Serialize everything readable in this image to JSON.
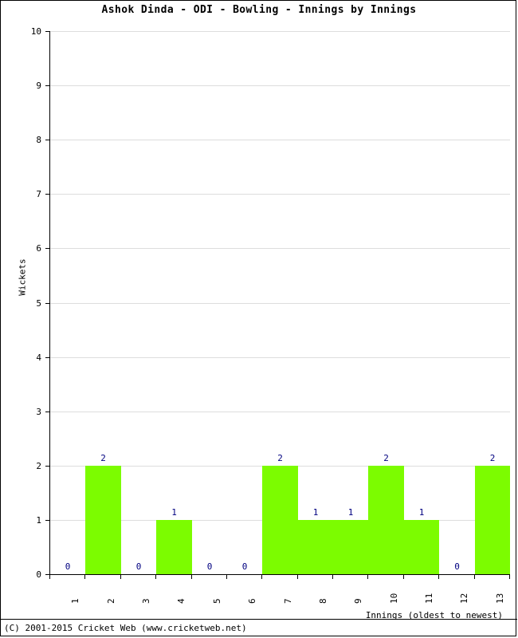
{
  "chart_data": {
    "type": "bar",
    "title": "Ashok Dinda - ODI - Bowling - Innings by Innings",
    "xlabel": "Innings (oldest to newest)",
    "ylabel": "Wickets",
    "categories": [
      "1",
      "2",
      "3",
      "4",
      "5",
      "6",
      "7",
      "8",
      "9",
      "10",
      "11",
      "12",
      "13"
    ],
    "values": [
      0,
      2,
      0,
      1,
      0,
      0,
      2,
      1,
      1,
      2,
      1,
      0,
      2
    ],
    "data_labels": [
      "0",
      "2",
      "0",
      "1",
      "0",
      "0",
      "2",
      "1",
      "1",
      "2",
      "1",
      "0",
      "2"
    ],
    "ylim": [
      0,
      10
    ],
    "y_ticks": [
      "0",
      "1",
      "2",
      "3",
      "4",
      "5",
      "6",
      "7",
      "8",
      "9",
      "10"
    ],
    "grid": true,
    "legend": null,
    "bar_color": "#7cfc00",
    "data_label_color": "#000080",
    "gridline_color": "#dddddd",
    "axis_color": "#000000"
  },
  "footer": {
    "copyright": "(C) 2001-2015 Cricket Web (www.cricketweb.net)"
  }
}
